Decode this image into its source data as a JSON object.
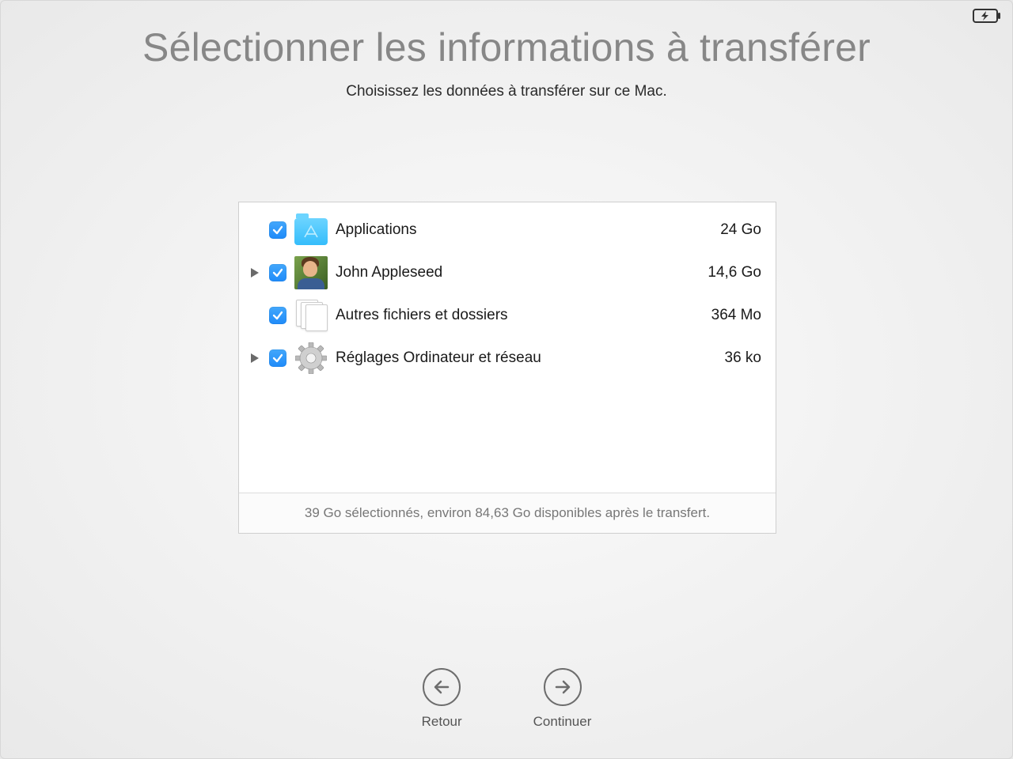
{
  "title": "Sélectionner les informations à transférer",
  "subtitle": "Choisissez les données à transférer sur ce Mac.",
  "items": [
    {
      "label": "Applications",
      "size": "24 Go",
      "icon": "applications-folder-icon",
      "expandable": false,
      "checked": true
    },
    {
      "label": "John Appleseed",
      "size": "14,6 Go",
      "icon": "user-avatar-icon",
      "expandable": true,
      "checked": true
    },
    {
      "label": "Autres fichiers et dossiers",
      "size": "364 Mo",
      "icon": "documents-stack-icon",
      "expandable": false,
      "checked": true
    },
    {
      "label": "Réglages Ordinateur et réseau",
      "size": "36 ko",
      "icon": "gear-icon",
      "expandable": true,
      "checked": true
    }
  ],
  "summary": "39 Go sélectionnés, environ 84,63 Go disponibles après le transfert.",
  "nav": {
    "back": "Retour",
    "continue": "Continuer"
  }
}
